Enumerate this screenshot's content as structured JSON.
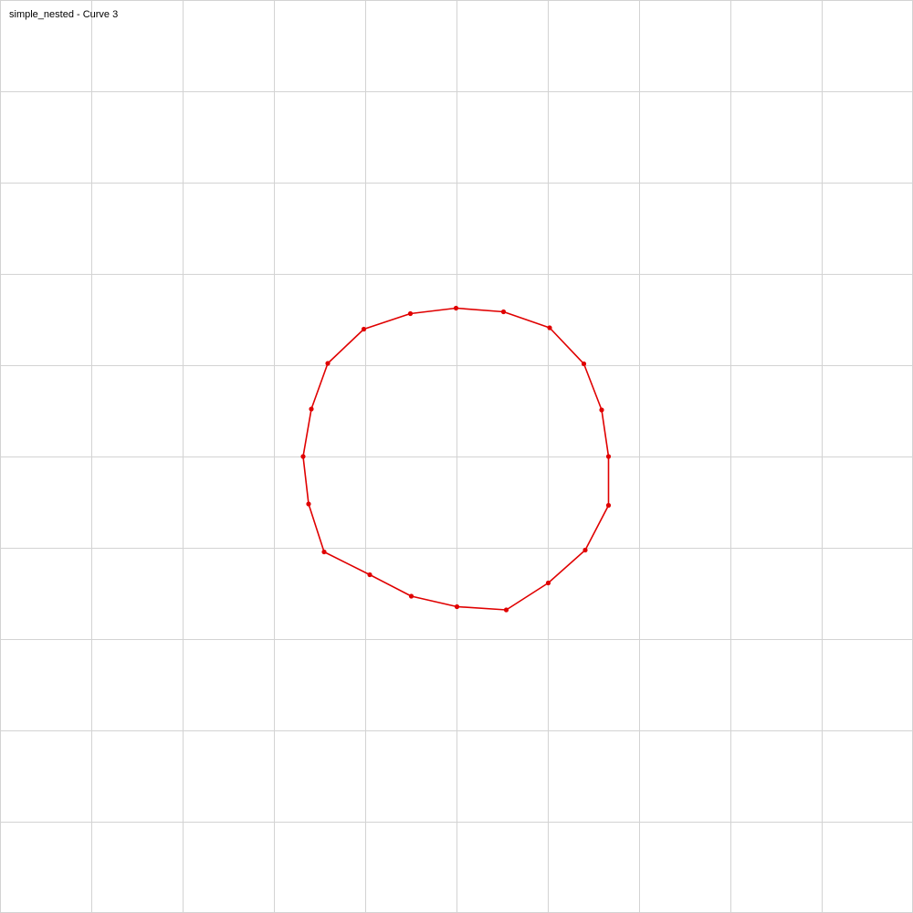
{
  "title": "simple_nested - Curve 3",
  "colors": {
    "background": "#ffffff",
    "grid": "#d3d3d3",
    "curve": "#e00000"
  },
  "grid": {
    "shown": true,
    "divisions": 10
  },
  "curve": {
    "closed": true,
    "vertices": [
      [
        499.5,
        337.5
      ],
      [
        551.5,
        341.5
      ],
      [
        602.0,
        359.0
      ],
      [
        639.5,
        398.5
      ],
      [
        659.0,
        449.0
      ],
      [
        666.5,
        500.0
      ],
      [
        666.5,
        553.5
      ],
      [
        641.0,
        602.5
      ],
      [
        600.5,
        638.5
      ],
      [
        554.5,
        668.0
      ],
      [
        500.5,
        664.5
      ],
      [
        450.5,
        653.0
      ],
      [
        405.0,
        629.5
      ],
      [
        355.0,
        604.5
      ],
      [
        338.0,
        552.0
      ],
      [
        332.0,
        500.0
      ],
      [
        341.0,
        448.0
      ],
      [
        359.0,
        398.0
      ],
      [
        398.5,
        360.5
      ],
      [
        449.5,
        343.5
      ]
    ]
  }
}
